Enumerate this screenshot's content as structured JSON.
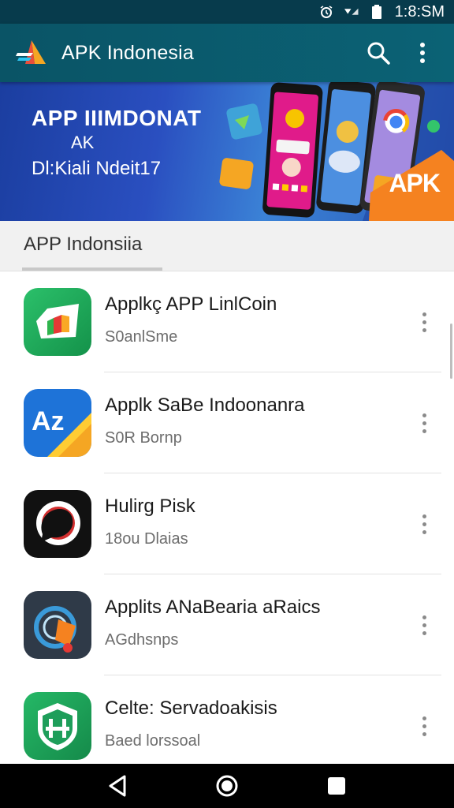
{
  "status_bar": {
    "time": "1:8:SM"
  },
  "app_bar": {
    "title": "APK Indonesia",
    "search_icon": "search-icon",
    "menu_icon": "more-vert-icon"
  },
  "banner": {
    "line1": "APP IIIMDONAT",
    "line2": "AK",
    "line3": "Dl:Kiali Ndeit17",
    "badge": "APK"
  },
  "section": {
    "title": "APP Indonsiia"
  },
  "apps": [
    {
      "name": "Applkç APP LinlCoin",
      "sub": "S0anlSme",
      "icon": "green-folder-icon",
      "icon_bg": "#1faa59"
    },
    {
      "name": "Applk SaBe Indoonanra",
      "sub": "S0R Bornp",
      "icon": "az-icon",
      "icon_bg": "#1e73d8"
    },
    {
      "name": "Hulirg Pisk",
      "sub": "18ou Dlaias",
      "icon": "chat-bubble-icon",
      "icon_bg": "#111111"
    },
    {
      "name": "Applits ANaBearia aRaics",
      "sub": "AGdhsnps",
      "icon": "tag-icon",
      "icon_bg": "#2f3a48"
    },
    {
      "name": "Celte: Servadoakisis",
      "sub": "Baed lorssoal",
      "icon": "shield-icon",
      "icon_bg": "#1e9e5a"
    }
  ],
  "colors": {
    "app_bar": "#0a5466",
    "status_bar": "#073b4c",
    "accent_orange": "#f58220"
  }
}
